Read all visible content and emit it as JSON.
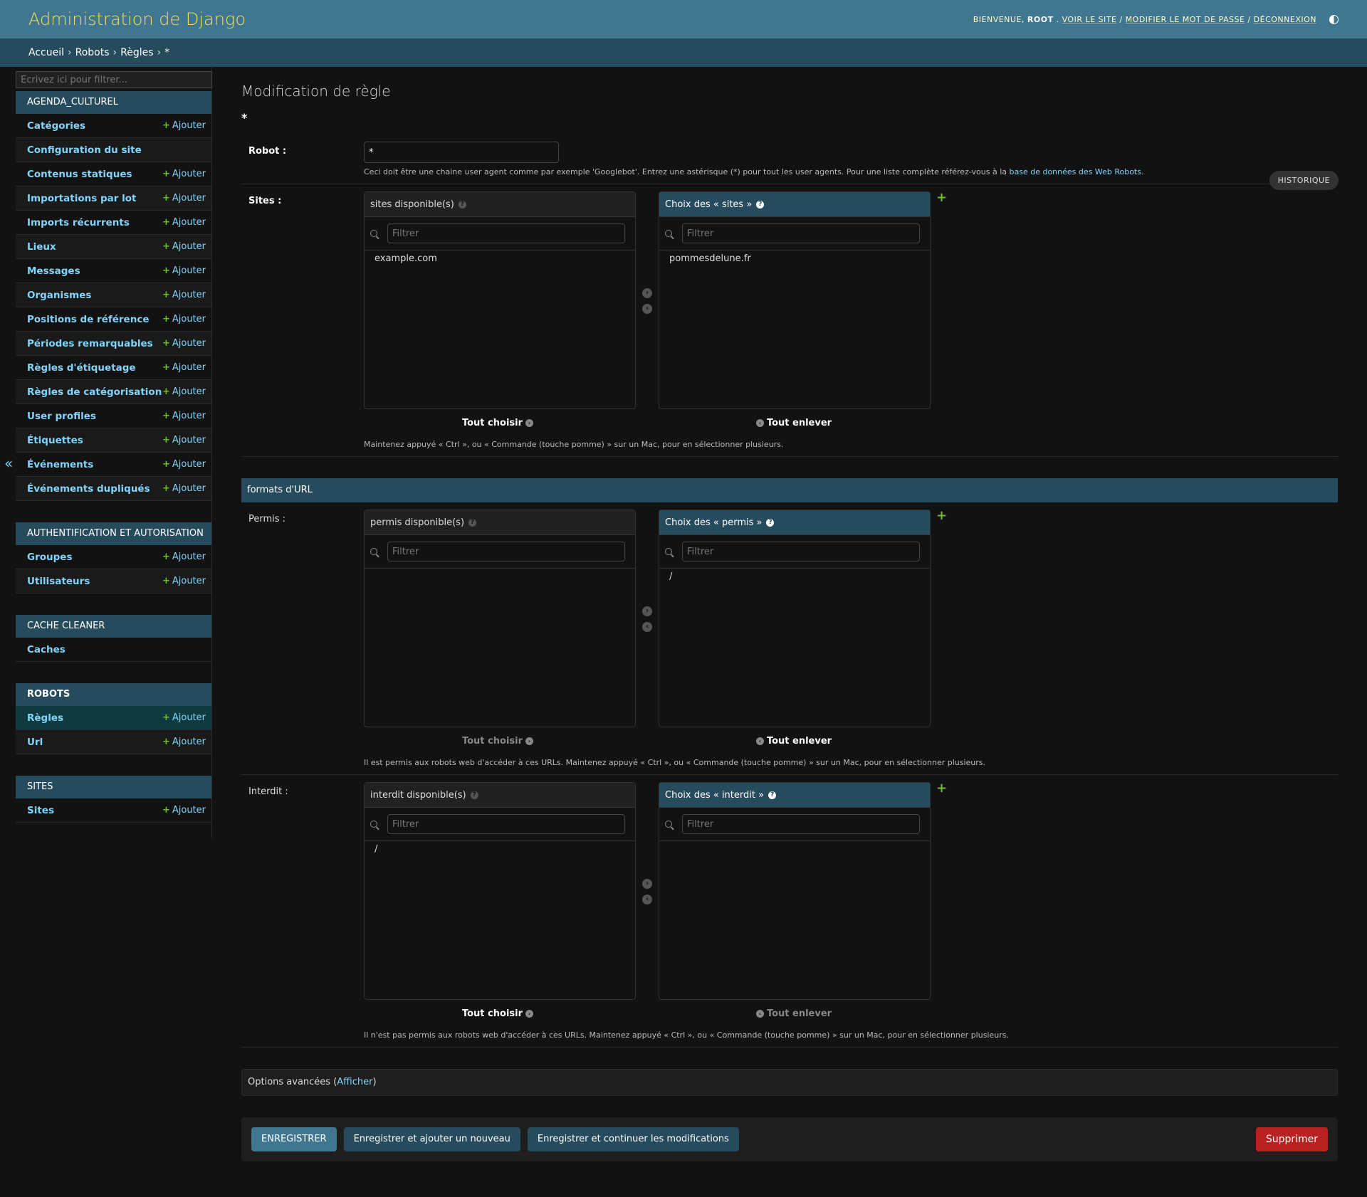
{
  "header": {
    "branding": "Administration de Django",
    "welcome": "BIENVENUE,",
    "user": "ROOT",
    "view_site": "VOIR LE SITE",
    "change_password": "MODIFIER LE MOT DE PASSE",
    "logout": "DÉCONNEXION"
  },
  "breadcrumbs": [
    "Accueil",
    "Robots",
    "Règles",
    "*"
  ],
  "nav": {
    "filter_placeholder": "Écrivez ici pour filtrer...",
    "add_label": "Ajouter",
    "apps": [
      {
        "name": "AGENDA_CULTUREL",
        "models": [
          {
            "label": "Catégories",
            "add": true
          },
          {
            "label": "Configuration du site",
            "add": false
          },
          {
            "label": "Contenus statiques",
            "add": true
          },
          {
            "label": "Importations par lot",
            "add": true
          },
          {
            "label": "Imports récurrents",
            "add": true
          },
          {
            "label": "Lieux",
            "add": true
          },
          {
            "label": "Messages",
            "add": true
          },
          {
            "label": "Organismes",
            "add": true
          },
          {
            "label": "Positions de référence",
            "add": true
          },
          {
            "label": "Périodes remarquables",
            "add": true
          },
          {
            "label": "Règles d'étiquetage",
            "add": true
          },
          {
            "label": "Règles de catégorisation",
            "add": true
          },
          {
            "label": "User profiles",
            "add": true
          },
          {
            "label": "Étiquettes",
            "add": true
          },
          {
            "label": "Événements",
            "add": true
          },
          {
            "label": "Événements dupliqués",
            "add": true
          }
        ]
      },
      {
        "name": "AUTHENTIFICATION ET AUTORISATION",
        "models": [
          {
            "label": "Groupes",
            "add": true
          },
          {
            "label": "Utilisateurs",
            "add": true
          }
        ]
      },
      {
        "name": "CACHE CLEANER",
        "models": [
          {
            "label": "Caches",
            "add": false
          }
        ]
      },
      {
        "name": "ROBOTS",
        "current": true,
        "models": [
          {
            "label": "Règles",
            "add": true,
            "current": true
          },
          {
            "label": "Url",
            "add": true
          }
        ]
      },
      {
        "name": "SITES",
        "models": [
          {
            "label": "Sites",
            "add": true
          }
        ]
      }
    ]
  },
  "content": {
    "title": "Modification de règle",
    "object_name": "*",
    "history": "HISTORIQUE",
    "robot": {
      "label": "Robot :",
      "value": "*",
      "help": "Ceci doit être une chaine user agent comme par exemple 'Googlebot'. Entrez une astérisque (*) pour tout les user agents. Pour une liste complète référez-vous à la",
      "help_link": "base de données des Web Robots",
      "help_end": "."
    },
    "filter_placeholder": "Filtrer",
    "choose_all": "Tout choisir",
    "remove_all": "Tout enlever",
    "sites": {
      "label": "Sites :",
      "available_title": "sites disponible(s)",
      "chosen_title": "Choix des « sites »",
      "available": [
        "example.com"
      ],
      "chosen": [
        "pommesdelune.fr"
      ],
      "help": "Maintenez appuyé « Ctrl », ou « Commande (touche pomme) » sur un Mac, pour en sélectionner plusieurs."
    },
    "fieldset_title": "formats d'URL",
    "permis": {
      "label": "Permis :",
      "available_title": "permis disponible(s)",
      "chosen_title": "Choix des « permis »",
      "available": [],
      "chosen": [
        "/"
      ],
      "help": "Il est permis aux robots web d'accéder à ces URLs. Maintenez appuyé « Ctrl », ou « Commande (touche pomme) » sur un Mac, pour en sélectionner plusieurs."
    },
    "interdit": {
      "label": "Interdit :",
      "available_title": "interdit disponible(s)",
      "chosen_title": "Choix des « interdit »",
      "available": [
        "/"
      ],
      "chosen": [],
      "help": "Il n'est pas permis aux robots web d'accéder à ces URLs. Maintenez appuyé « Ctrl », ou « Commande (touche pomme) » sur un Mac, pour en sélectionner plusieurs."
    },
    "advanced": {
      "label": "Options avancées (",
      "link": "Afficher",
      "end": ")"
    },
    "buttons": {
      "save": "ENREGISTRER",
      "save_add": "Enregistrer et ajouter un nouveau",
      "save_continue": "Enregistrer et continuer les modifications",
      "delete": "Supprimer"
    }
  }
}
